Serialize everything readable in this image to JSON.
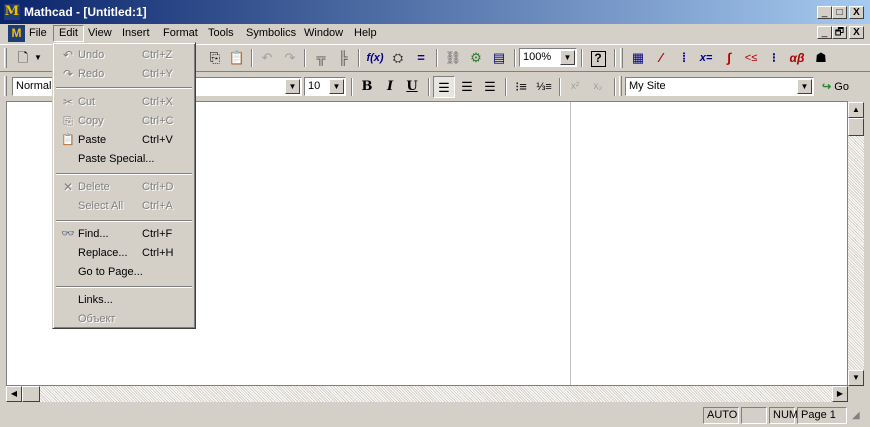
{
  "window": {
    "title": "Mathcad - [Untitled:1]",
    "app_glyph": "M",
    "caption_buttons": [
      "_",
      "□",
      "X"
    ],
    "doc_buttons": [
      "_",
      "🗗",
      "X"
    ]
  },
  "menubar": {
    "items": [
      "File",
      "Edit",
      "View",
      "Insert",
      "Format",
      "Tools",
      "Symbolics",
      "Window",
      "Help"
    ],
    "active": "Edit"
  },
  "standard_toolbar": {
    "zoom_value": "100%",
    "help_glyph": "?"
  },
  "format_toolbar": {
    "style_value": "Normal",
    "size_value": "10",
    "bold": "B",
    "italic": "I",
    "underline": "U",
    "superscript": "x²",
    "subscript": "x₂"
  },
  "web_toolbar": {
    "site_value": "My Site",
    "go_label": "Go"
  },
  "math_toolbar": {
    "calc": "▦",
    "graph": "⁄",
    "matrix": "⁞",
    "eval": "x=",
    "calculus": "∫",
    "boolean": "<≤",
    "programming": "⁝",
    "greek": "αβ",
    "symbolic": "☗"
  },
  "edit_menu": {
    "items": [
      {
        "label": "Undo",
        "shortcut": "Ctrl+Z",
        "icon": "undo-icon",
        "glyph": "↶",
        "enabled": false
      },
      {
        "label": "Redo",
        "shortcut": "Ctrl+Y",
        "icon": "redo-icon",
        "glyph": "↷",
        "enabled": false
      },
      {
        "label": "Cut",
        "shortcut": "Ctrl+X",
        "icon": "scissors-icon",
        "glyph": "✂",
        "enabled": false
      },
      {
        "label": "Copy",
        "shortcut": "Ctrl+C",
        "icon": "copy-icon",
        "glyph": "⎘",
        "enabled": false
      },
      {
        "label": "Paste",
        "shortcut": "Ctrl+V",
        "icon": "paste-icon",
        "glyph": "📋",
        "enabled": true
      },
      {
        "label": "Paste Special...",
        "shortcut": "",
        "icon": "",
        "glyph": "",
        "enabled": true
      },
      {
        "label": "Delete",
        "shortcut": "Ctrl+D",
        "icon": "delete-icon",
        "glyph": "✕",
        "enabled": false
      },
      {
        "label": "Select All",
        "shortcut": "Ctrl+A",
        "icon": "",
        "glyph": "",
        "enabled": false
      },
      {
        "label": "Find...",
        "shortcut": "Ctrl+F",
        "icon": "binoculars-icon",
        "glyph": "👓",
        "enabled": true
      },
      {
        "label": "Replace...",
        "shortcut": "Ctrl+H",
        "icon": "",
        "glyph": "",
        "enabled": true
      },
      {
        "label": "Go to Page...",
        "shortcut": "",
        "icon": "",
        "glyph": "",
        "enabled": true
      },
      {
        "label": "Links...",
        "shortcut": "",
        "icon": "",
        "glyph": "",
        "enabled": true
      },
      {
        "label": "Объект",
        "shortcut": "",
        "icon": "",
        "glyph": "",
        "enabled": false
      }
    ]
  },
  "statusbar": {
    "mode": "AUTO",
    "caps": "",
    "num": "NUM",
    "page": "Page 1"
  },
  "colors": {
    "title_gradient_start": "#0a246a",
    "title_gradient_end": "#a6caf0",
    "face": "#d4d0c8"
  }
}
